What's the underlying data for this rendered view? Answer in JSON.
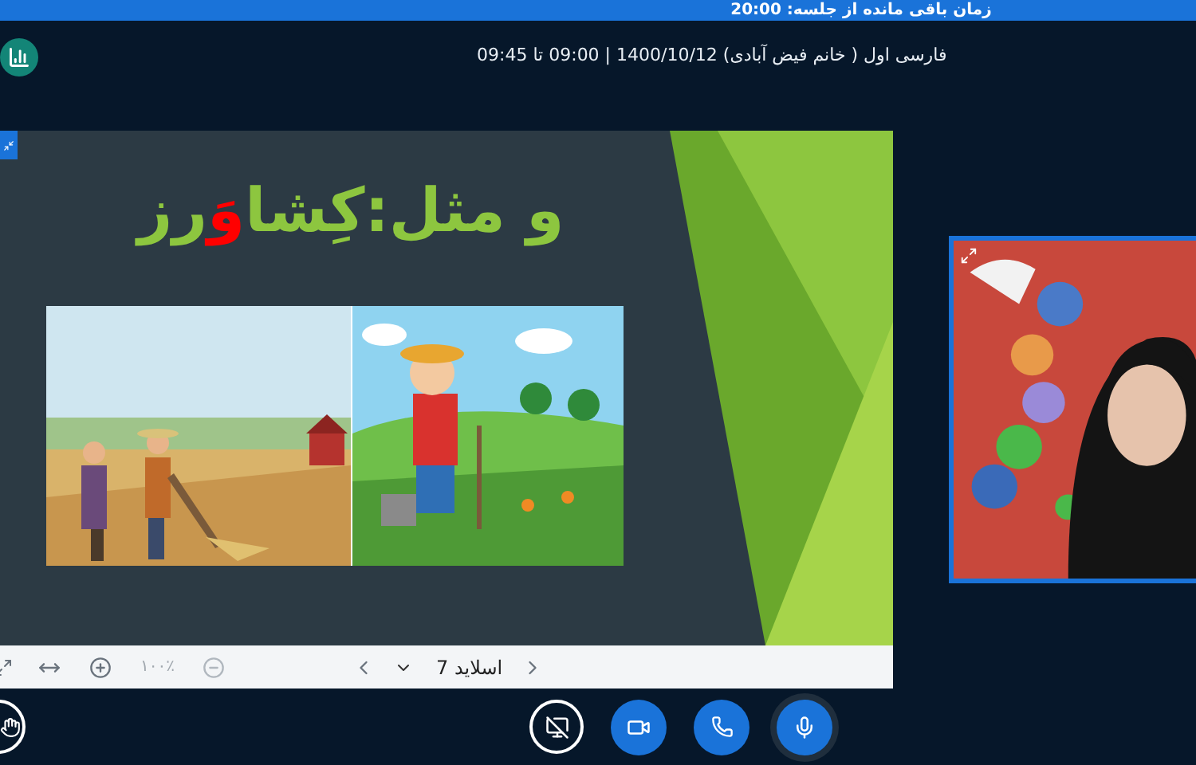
{
  "banner": {
    "text": "زمان باقی مانده از جلسه: 20:00"
  },
  "header": {
    "title": "فارسی اول ( خانم فیض آبادی) 1400/10/12 | 09:00 تا 09:45"
  },
  "slide": {
    "title": [
      {
        "text": "و مثل:کِشا",
        "color": "#8dc63f"
      },
      {
        "text": "وَ",
        "color": "#ff0000"
      },
      {
        "text": "رز",
        "color": "#8dc63f"
      }
    ]
  },
  "toolbar": {
    "zoom": "۱۰۰٪",
    "slide_label": "اسلاید 7"
  }
}
